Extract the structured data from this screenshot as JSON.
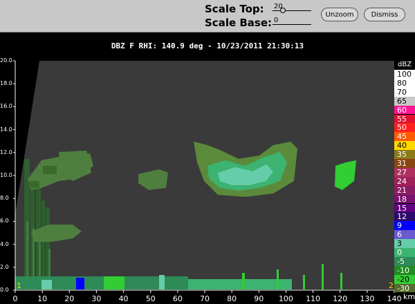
{
  "toolbar": {
    "scale_top_label": "Scale Top:",
    "scale_top_value": "20",
    "scale_top_fraction": 0.22,
    "scale_base_label": "Scale Base:",
    "scale_base_value": "0",
    "scale_base_fraction": 0.0,
    "unzoom_label": "Unzoom",
    "dismiss_label": "Dismiss"
  },
  "plot": {
    "title": "DBZ F  RHI: 140.9 deg  -  10/23/2011 21:30:13",
    "x_unit": "km",
    "x_ticks": [
      "0",
      "10",
      "20",
      "30",
      "40",
      "50",
      "60",
      "70",
      "80",
      "90",
      "100",
      "110",
      "120",
      "130",
      "140"
    ],
    "y_ticks": [
      "0.0",
      "2.0",
      "4.0",
      "6.0",
      "8.0",
      "10.0",
      "12.0",
      "14.0",
      "16.0",
      "18.0",
      "20.0"
    ],
    "corner_marker_left": "1",
    "corner_marker_right": "2",
    "x_range": [
      0,
      140
    ],
    "y_range": [
      0,
      20
    ]
  },
  "legend": {
    "title": "dBZ",
    "entries": [
      {
        "label": "100",
        "color": "#ffffff",
        "text": "#000000"
      },
      {
        "label": "80",
        "color": "#ffffff",
        "text": "#000000"
      },
      {
        "label": "70",
        "color": "#ffffff",
        "text": "#000000"
      },
      {
        "label": "65",
        "color": "#c8c8c8",
        "text": "#000000"
      },
      {
        "label": "60",
        "color": "#ff1493",
        "text": "#ffffff"
      },
      {
        "label": "55",
        "color": "#e01030",
        "text": "#ffffff"
      },
      {
        "label": "50",
        "color": "#ff2020",
        "text": "#ffffff"
      },
      {
        "label": "45",
        "color": "#ff5a00",
        "text": "#ffffff"
      },
      {
        "label": "40",
        "color": "#ffd700",
        "text": "#000000"
      },
      {
        "label": "35",
        "color": "#8b7a1a",
        "text": "#ffffff"
      },
      {
        "label": "31",
        "color": "#8b4513",
        "text": "#ffffff"
      },
      {
        "label": "27",
        "color": "#b03060",
        "text": "#ffffff"
      },
      {
        "label": "24",
        "color": "#a0205a",
        "text": "#ffffff"
      },
      {
        "label": "21",
        "color": "#8b1c62",
        "text": "#ffffff"
      },
      {
        "label": "18",
        "color": "#7a1070",
        "text": "#ffffff"
      },
      {
        "label": "15",
        "color": "#600080",
        "text": "#ffffff"
      },
      {
        "label": "12",
        "color": "#2a0a6a",
        "text": "#ffffff"
      },
      {
        "label": "9",
        "color": "#0000ff",
        "text": "#ffffff"
      },
      {
        "label": "6",
        "color": "#6a5acd",
        "text": "#ffffff"
      },
      {
        "label": "3",
        "color": "#66cdaa",
        "text": "#000000"
      },
      {
        "label": "0",
        "color": "#3cb371",
        "text": "#ffffff"
      },
      {
        "label": "-5",
        "color": "#2e8b57",
        "text": "#ffffff"
      },
      {
        "label": "-10",
        "color": "#228b22",
        "text": "#ffffff"
      },
      {
        "label": "-20",
        "color": "#32cd32",
        "text": "#000000"
      },
      {
        "label": "-30",
        "color": "#556b2f",
        "text": "#ffffff"
      }
    ]
  }
}
